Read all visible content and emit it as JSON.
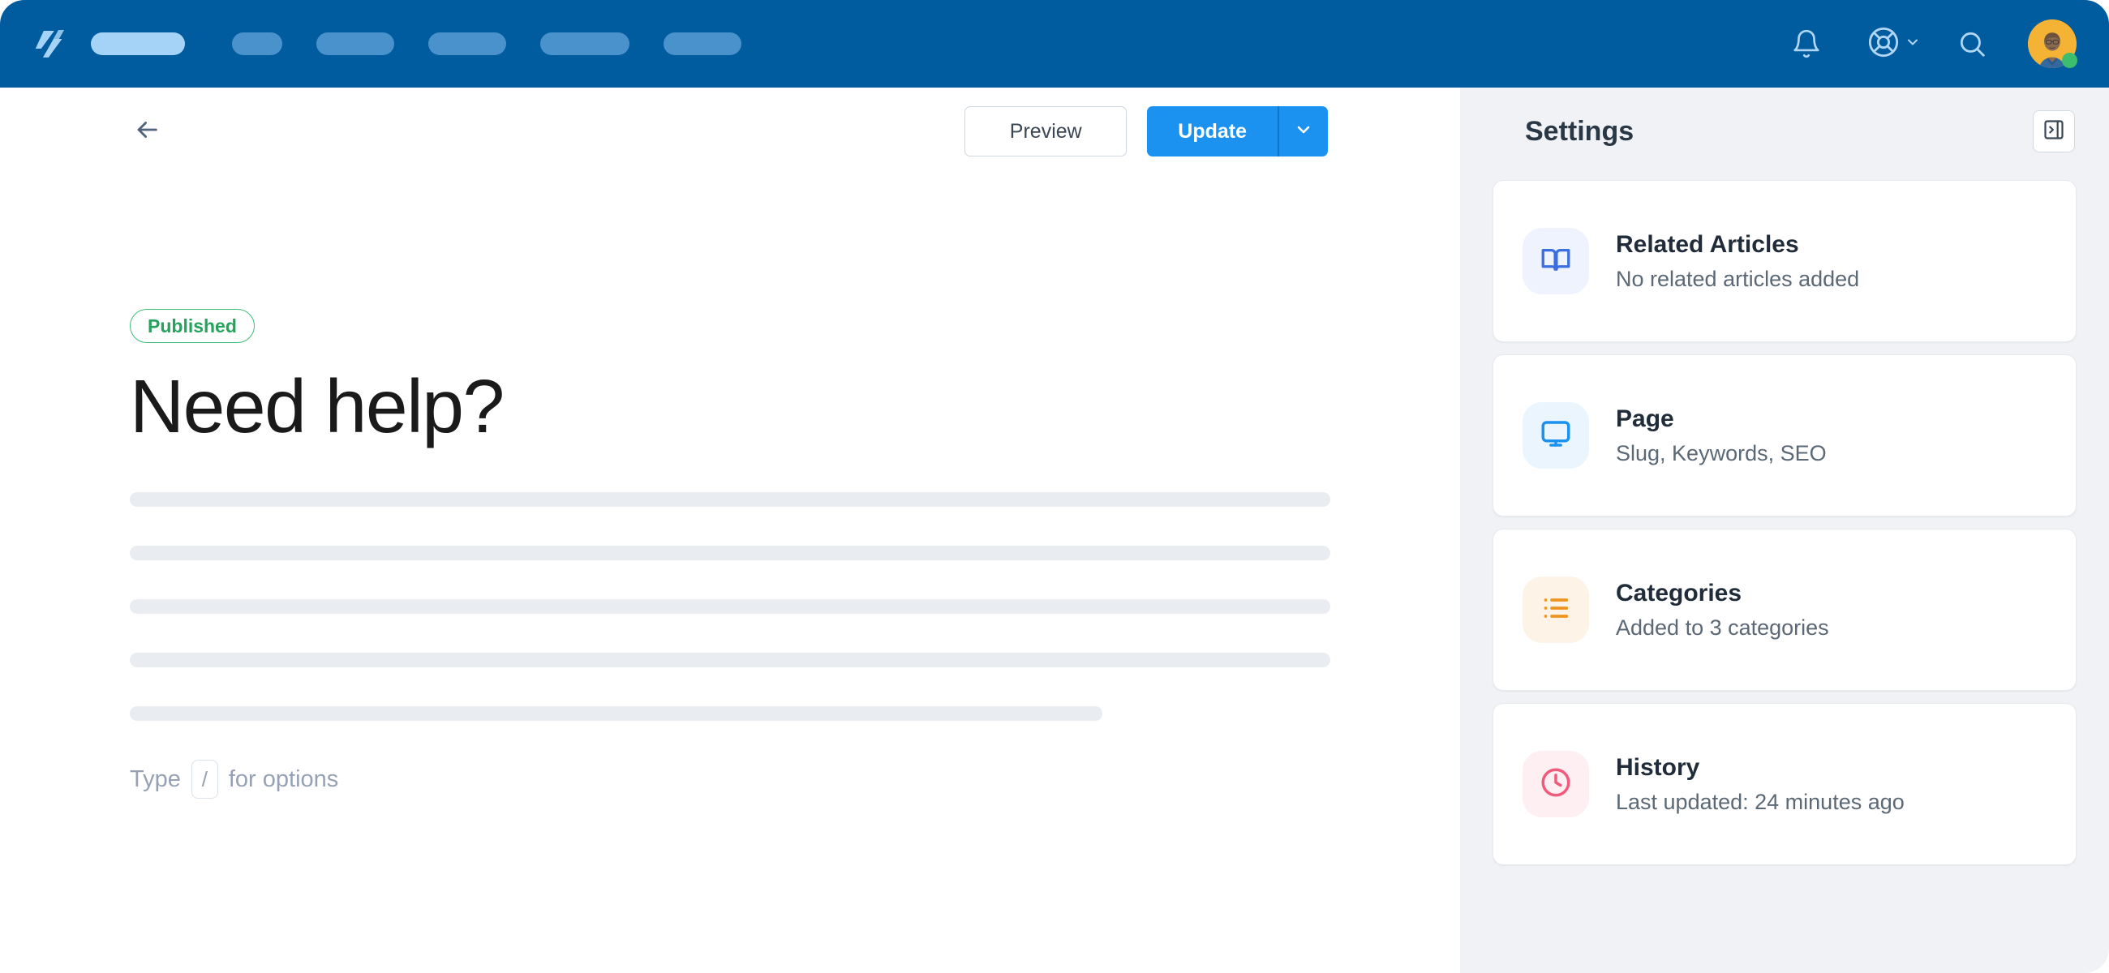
{
  "window": {
    "accent_blue": "#1B91F0",
    "navbar_blue": "#005C9E",
    "panel_bg": "#F0F2F5"
  },
  "navbar": {
    "logo_name": "helpscout-logo",
    "pills": [
      {
        "name": "nav-pill-active",
        "width": 116,
        "active": true,
        "gap_after": 58
      },
      {
        "name": "nav-pill-2",
        "width": 62,
        "active": false,
        "gap_after": 42
      },
      {
        "name": "nav-pill-3",
        "width": 96,
        "active": false,
        "gap_after": 42
      },
      {
        "name": "nav-pill-4",
        "width": 96,
        "active": false,
        "gap_after": 42
      },
      {
        "name": "nav-pill-5",
        "width": 110,
        "active": false,
        "gap_after": 42
      },
      {
        "name": "nav-pill-6",
        "width": 96,
        "active": false,
        "gap_after": 0
      }
    ],
    "icons": {
      "notifications": "bell-icon",
      "help": "lifebuoy-icon",
      "help_caret": "chevron-down-icon",
      "search": "search-icon",
      "avatar": "user-avatar",
      "status": "online-status-dot"
    }
  },
  "toolbar": {
    "back_label": "arrow-left-icon",
    "preview_label": "Preview",
    "update_label": "Update",
    "update_caret": "chevron-down-icon"
  },
  "document": {
    "status_badge": "Published",
    "title": "Need help?",
    "skeleton_lines": [
      100,
      100,
      100,
      100,
      81
    ],
    "hint_prefix": "Type",
    "hint_key": "/",
    "hint_suffix": "for options"
  },
  "settings": {
    "title": "Settings",
    "collapse_icon": "panel-collapse-icon",
    "cards": [
      {
        "title": "Related Articles",
        "subtitle": "No related articles added",
        "icon": "book-open-icon",
        "icon_color": "#3B6FE0",
        "icon_bg": "#EEF3FE"
      },
      {
        "title": "Page",
        "subtitle": "Slug, Keywords, SEO",
        "icon": "monitor-icon",
        "icon_color": "#1B91F0",
        "icon_bg": "#EAF5FE"
      },
      {
        "title": "Categories",
        "subtitle": "Added to 3 categories",
        "icon": "list-icon",
        "icon_color": "#EE9420",
        "icon_bg": "#FDF3E6"
      },
      {
        "title": "History",
        "subtitle": "Last updated: 24 minutes ago",
        "icon": "clock-icon",
        "icon_color": "#F2597B",
        "icon_bg": "#FDEFF2"
      }
    ]
  }
}
